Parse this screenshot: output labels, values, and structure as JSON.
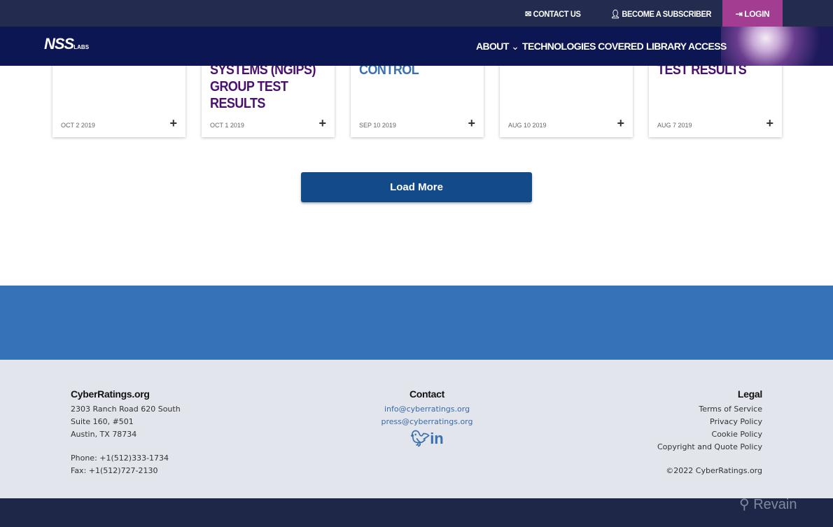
{
  "topbar": {
    "contact": "CONTACT US",
    "subscribe": "BECOME A SUBSCRIBER",
    "login": "LOGIN"
  },
  "nav": {
    "logo": "NSS",
    "logo_sub": "LABS",
    "about": "ABOUT",
    "technologies": "TECHNOLOGIES COVERED",
    "library": "LIBRARY ACCESS"
  },
  "cards": [
    {
      "title": "",
      "date": "OCT 2 2019",
      "color": "#4a1070"
    },
    {
      "title": "SYSTEMS (NGIPS) GROUP TEST RESULTS",
      "date": "OCT 1 2019",
      "color": "#4a1070"
    },
    {
      "title": "CONTROL",
      "date": "SEP 10 2019",
      "color": "#3a6fb0"
    },
    {
      "title": "",
      "date": "AUG 10 2019",
      "color": "#4a1070"
    },
    {
      "title": "TEST RESULTS",
      "date": "AUG 7 2019",
      "color": "#4a1070"
    }
  ],
  "load_more": "Load More",
  "footer": {
    "org": {
      "heading": "CyberRatings.org",
      "address1": "2303 Ranch Road 620 South",
      "address2": "Suite 160, #501",
      "address3": "Austin, TX 78734",
      "phone": "Phone: +1(512)333-1734",
      "fax": "Fax: +1(512)727-2130"
    },
    "contact": {
      "heading": "Contact",
      "email1": "info@cyberratings.org",
      "email2": "press@cyberratings.org"
    },
    "legal": {
      "heading": "Legal",
      "terms": "Terms of Service",
      "privacy": "Privacy Policy",
      "cookie": "Cookie Policy",
      "copyright_policy": "Copyright and Quote Policy",
      "copyright": "©2022 CyberRatings.org"
    }
  },
  "watermark": "Revain"
}
